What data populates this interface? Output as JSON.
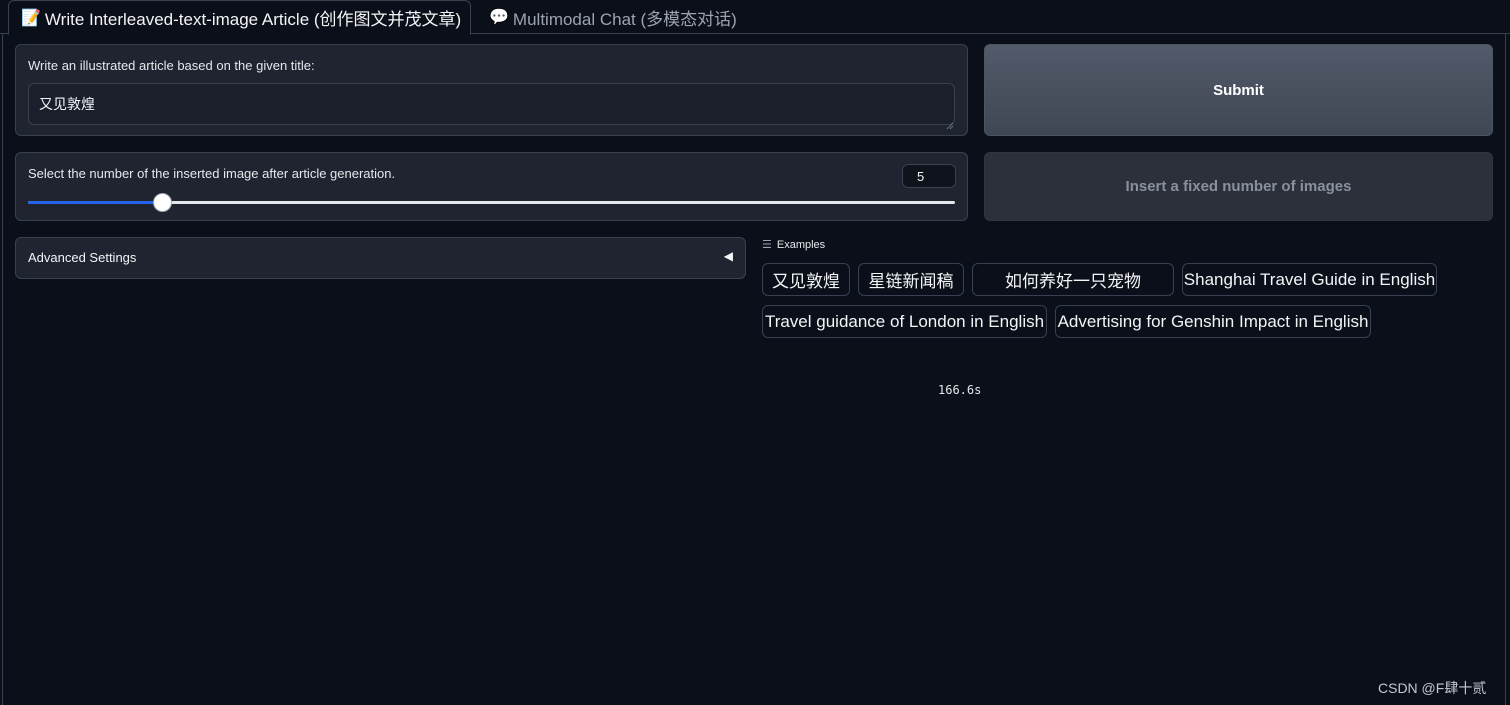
{
  "tabs": [
    {
      "icon": "📝",
      "label": "Write Interleaved-text-image Article (创作图文并茂文章)",
      "active": true
    },
    {
      "icon": "💬",
      "label": "Multimodal Chat (多模态对话)",
      "active": false
    }
  ],
  "title_panel": {
    "label": "Write an illustrated article based on the given title:",
    "value": "又见敦煌"
  },
  "slider_panel": {
    "label": "Select the number of the inserted image after article generation.",
    "value": "5",
    "fraction": 0.146
  },
  "buttons": {
    "submit": "Submit",
    "insert_fixed": "Insert a fixed number of images"
  },
  "advanced": {
    "label": "Advanced Settings",
    "caret": "◀"
  },
  "examples": {
    "header": "Examples",
    "items": [
      "又见敦煌",
      "星链新闻稿",
      "如何养好一只宠物",
      "Shanghai Travel Guide in English",
      "Travel guidance of London in English",
      "Advertising for Genshin Impact in English"
    ]
  },
  "timer": "166.6s",
  "watermark": "CSDN @F肆十贰",
  "colors": {
    "background": "#0b0f19",
    "panel": "#1f2430",
    "accent": "#2563eb",
    "submit": "#4b5563"
  }
}
